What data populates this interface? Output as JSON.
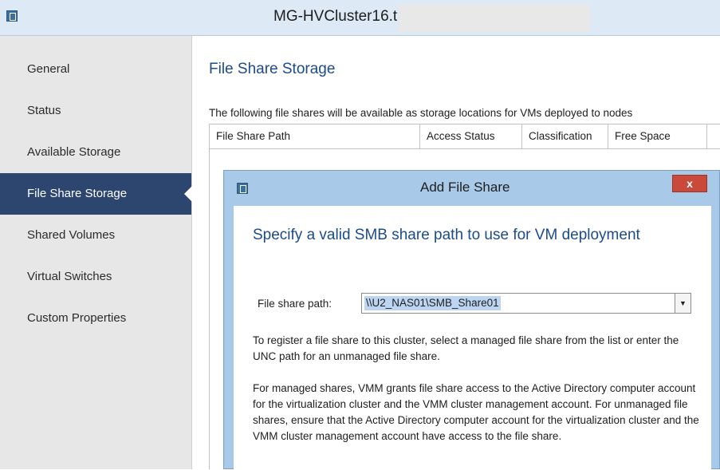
{
  "window": {
    "title": "MG-HVCluster16.t"
  },
  "nav": {
    "items": [
      {
        "label": "General"
      },
      {
        "label": "Status"
      },
      {
        "label": "Available Storage"
      },
      {
        "label": "File Share Storage",
        "selected": true
      },
      {
        "label": "Shared Volumes"
      },
      {
        "label": "Virtual Switches"
      },
      {
        "label": "Custom Properties"
      }
    ]
  },
  "main": {
    "title": "File Share Storage",
    "description": "The following file shares will be available as storage locations for VMs deployed to nodes",
    "table": {
      "columns": [
        "File Share Path",
        "Access Status",
        "Classification",
        "Free Space"
      ]
    }
  },
  "dialog": {
    "title": "Add File Share",
    "close_label": "x",
    "heading": "Specify a valid SMB share path to use for VM deployment",
    "path_label": "File share path:",
    "path_value": "\\\\U2_NAS01\\SMB_Share01",
    "help_text_1": "To register a file share to this cluster, select a managed file share from the list or enter the UNC path for an unmanaged file share.",
    "help_text_2": "For managed shares, VMM grants file share access to the Active Directory computer account for the virtualization cluster and the VMM cluster management account. For unmanaged file shares, ensure that the Active Directory computer account for the virtualization cluster and the VMM cluster management account have access to the file share."
  },
  "colors": {
    "nav_selected": "#2d4670",
    "heading_blue": "#1c4b8a",
    "close_red": "#c94a3a",
    "dialog_frame": "#a8c9e8"
  }
}
